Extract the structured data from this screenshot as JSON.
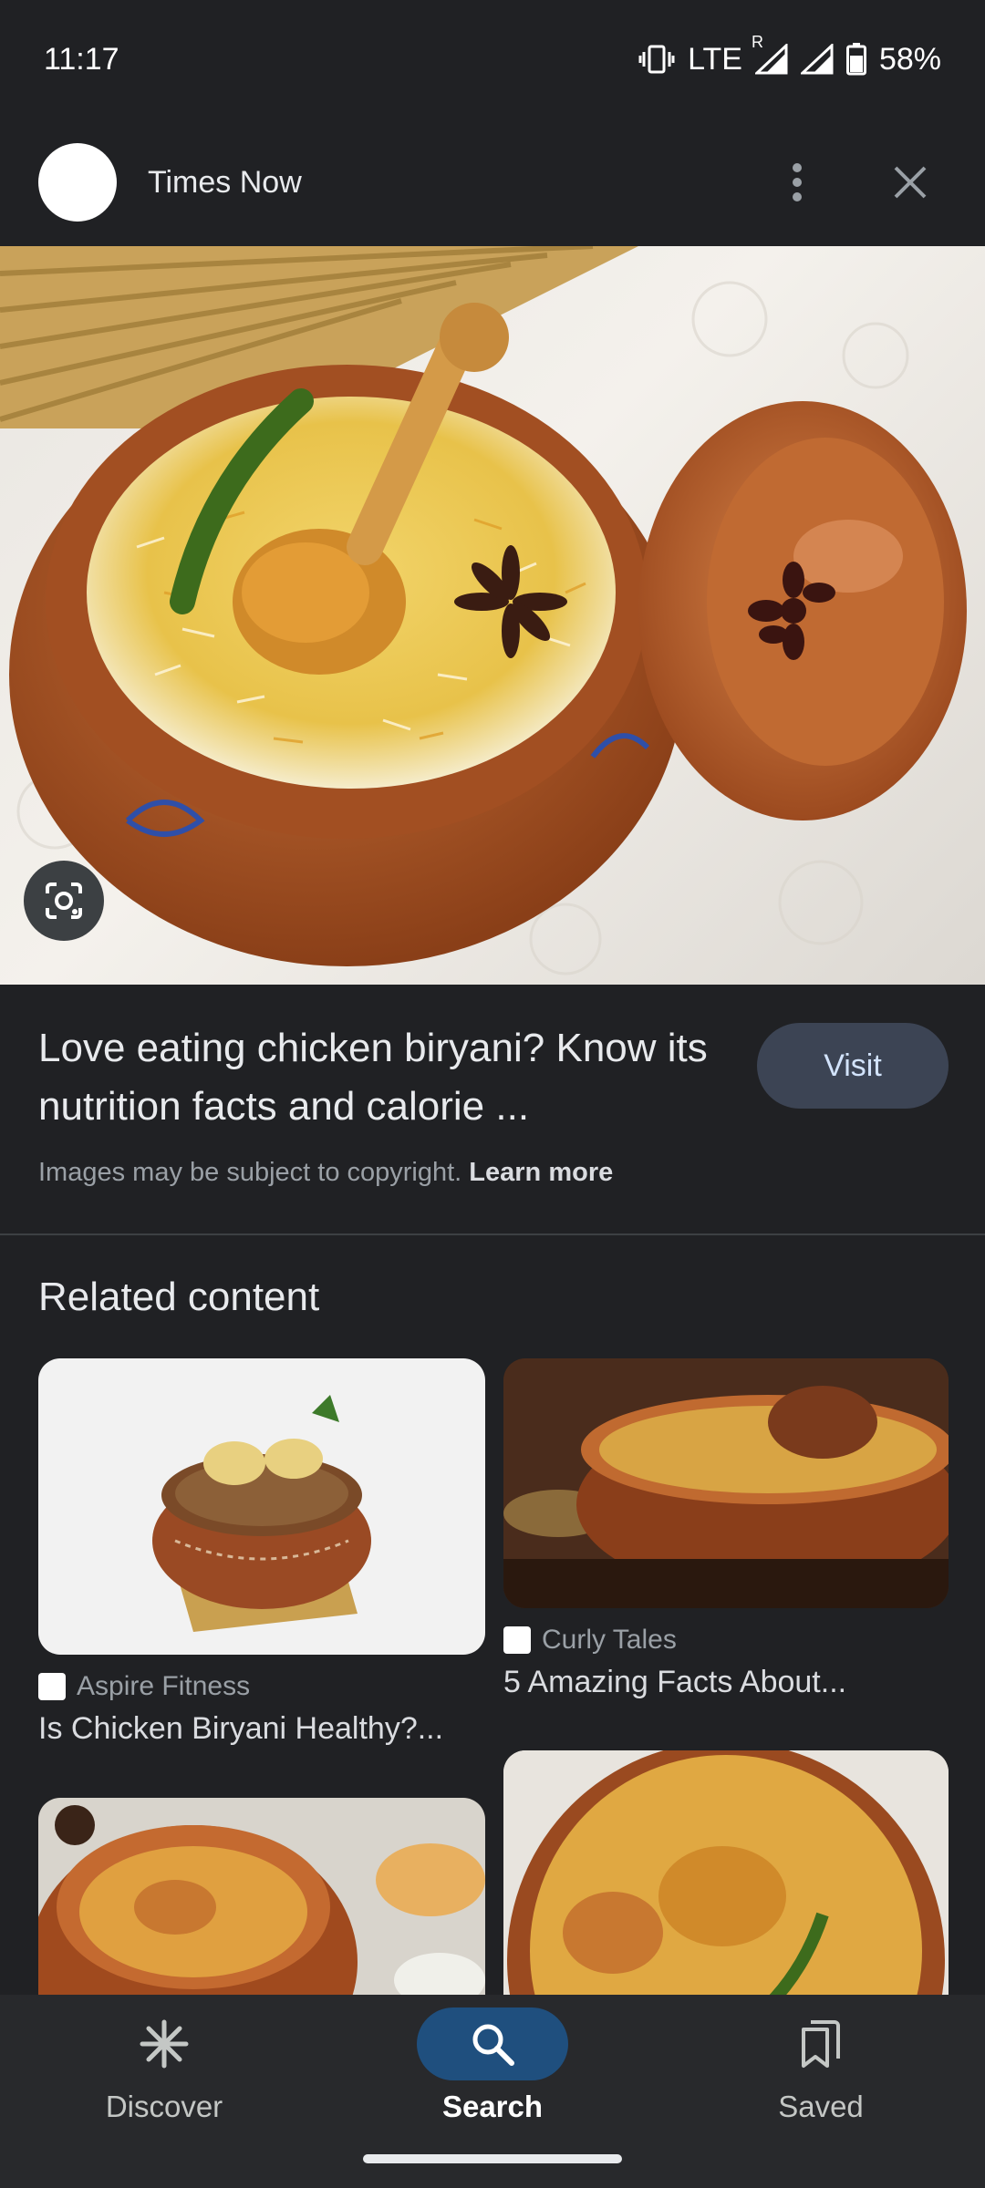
{
  "status_bar": {
    "time": "11:17",
    "network": "LTE",
    "roaming": "R",
    "battery": "58%",
    "icons": [
      "vibrate-icon",
      "signal-roaming-icon",
      "signal-icon",
      "battery-icon"
    ]
  },
  "header": {
    "site_name": "Times Now",
    "icons": [
      "more-vert-icon",
      "close-icon"
    ]
  },
  "hero": {
    "subject": "chicken biryani in clay pot",
    "lens_icon": "google-lens-icon"
  },
  "result": {
    "title": "Love eating chicken biryani? Know its nutrition facts and calorie ...",
    "visit_label": "Visit",
    "copyright_text": "Images may be subject to copyright.",
    "learn_more": "Learn more"
  },
  "related": {
    "heading": "Related content",
    "items": [
      {
        "source": "Aspire Fitness",
        "caption": "Is Chicken Biryani Healthy?..."
      },
      {
        "source": "Curly Tales",
        "caption": "5 Amazing Facts About..."
      }
    ]
  },
  "nav": {
    "items": [
      {
        "label": "Discover",
        "icon": "asterisk-icon"
      },
      {
        "label": "Search",
        "icon": "search-icon",
        "active": true
      },
      {
        "label": "Saved",
        "icon": "bookmarks-icon"
      }
    ]
  },
  "colors": {
    "background": "#202124",
    "visit_button": "#3c4454",
    "active_nav": "#1f4f7e"
  }
}
